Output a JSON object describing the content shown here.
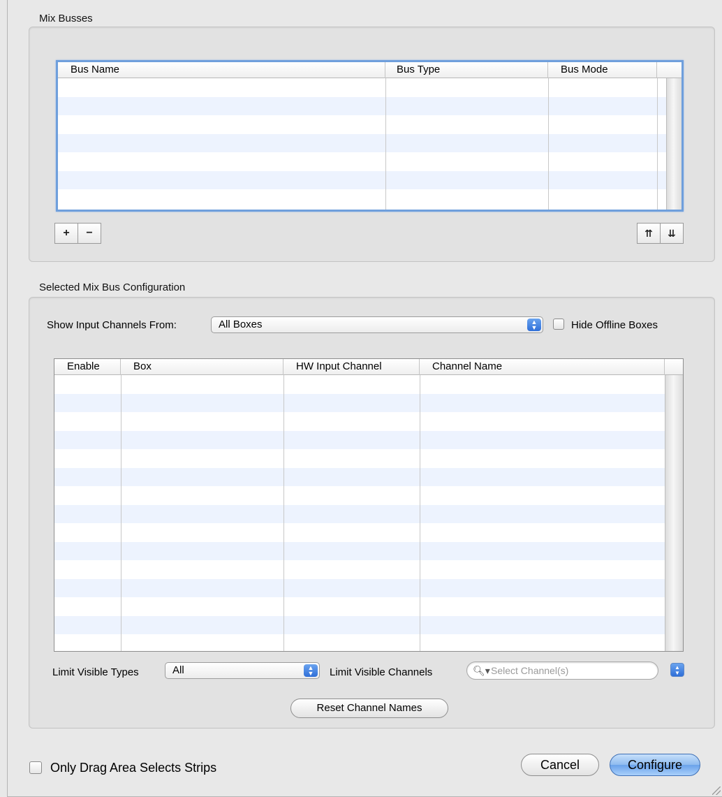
{
  "mix_busses": {
    "title": "Mix Busses",
    "columns": [
      "Bus Name",
      "Bus Type",
      "Bus Mode"
    ],
    "add_label": "+",
    "remove_label": "−",
    "move_top_label": "⇈",
    "move_bottom_label": "⇊"
  },
  "config": {
    "title": "Selected Mix Bus Configuration",
    "show_from_label": "Show Input Channels From:",
    "show_from_value": "All Boxes",
    "hide_offline_label": "Hide Offline Boxes",
    "columns": [
      "Enable",
      "Box",
      "HW Input Channel",
      "Channel Name"
    ],
    "limit_types_label": "Limit Visible Types",
    "limit_types_value": "All",
    "limit_channels_label": "Limit Visible Channels",
    "search_placeholder": "Select Channel(s)",
    "reset_label": "Reset Channel Names"
  },
  "footer": {
    "only_drag_label": "Only Drag Area Selects Strips",
    "cancel_label": "Cancel",
    "configure_label": "Configure"
  },
  "icons": {
    "popup": "popup-arrows-icon",
    "search": "magnifier-icon",
    "resize": "resize-grip-icon"
  },
  "colors": {
    "accent": "#3b7ee0",
    "row_stripe": "#edf3fe",
    "focus_ring": "#6f9fdc"
  }
}
